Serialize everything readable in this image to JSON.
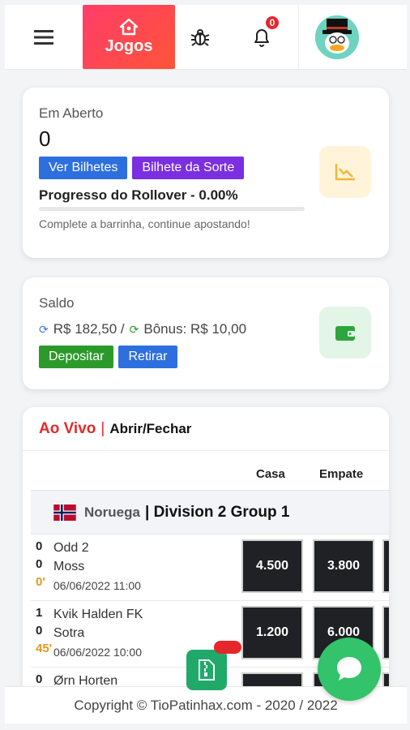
{
  "topbar": {
    "menu_icon": "hamburger-icon",
    "jogos_label": "Jogos",
    "jogos_icon": "home-icon",
    "bug_icon": "bug-icon",
    "bell_icon": "bell-icon",
    "notification_count": "0",
    "avatar": "duck-avatar"
  },
  "open_card": {
    "title": "Em Aberto",
    "value": "0",
    "btn_tickets": "Ver Bilhetes",
    "btn_luck": "Bilhete da Sorte",
    "rollover_label": "Progresso do Rollover - 0.00%",
    "rollover_progress": 0,
    "hint": "Complete a barrinha, continue apostando!",
    "icon": "chart-icon"
  },
  "balance_card": {
    "title": "Saldo",
    "amount": "R$ 182,50 /",
    "bonus": "Bônus: R$ 10,00",
    "btn_deposit": "Depositar",
    "btn_withdraw": "Retirar",
    "icon": "wallet-icon"
  },
  "live": {
    "title": "Ao Vivo",
    "separator": "|",
    "toggle": "Abrir/Fechar",
    "col_home": "Casa",
    "col_draw": "Empate",
    "league_country": "Noruega",
    "league_name": "| Division 2 Group 1",
    "matches": [
      {
        "score_home": "0",
        "score_away": "0",
        "minute": "0'",
        "home": "Odd 2",
        "away": "Moss",
        "datetime": "06/06/2022 11:00",
        "odd_home": "4.500",
        "odd_draw": "3.800"
      },
      {
        "score_home": "1",
        "score_away": "0",
        "minute": "45'",
        "home": "Kvik Halden FK",
        "away": "Sotra",
        "datetime": "06/06/2022 10:00",
        "odd_home": "1.200",
        "odd_draw": "6.000"
      },
      {
        "score_home": "0",
        "home": "Ørn Horten"
      }
    ]
  },
  "footer": {
    "copyright": "Copyright © TioPatinhax.com - 2020 / 2022"
  },
  "colors": {
    "accent": "#ff3d6a",
    "live_red": "#e32929",
    "chat_green": "#32c36b",
    "odd_bg": "#202124"
  }
}
